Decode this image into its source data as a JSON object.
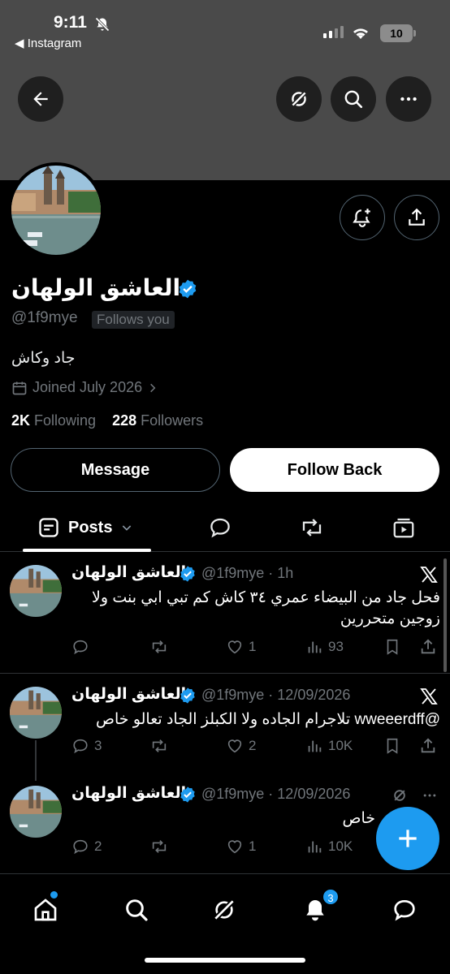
{
  "status_bar": {
    "time": "9:11",
    "back_app": "◀ Instagram",
    "battery": "10"
  },
  "icons": {
    "back": "arrow-left-icon",
    "grok": "grok-icon",
    "search": "search-icon",
    "more": "more-horizontal-icon",
    "notify": "bell-plus-icon",
    "share": "share-icon",
    "verified": "verified-badge-icon",
    "calendar": "calendar-icon",
    "chevron_right": "chevron-right-icon",
    "x_logo": "x-logo-icon",
    "posts_tab": "posts-icon",
    "replies_tab": "reply-icon",
    "reposts_tab": "repost-icon",
    "media_tab": "media-icon",
    "home": "home-icon",
    "explore": "search-icon",
    "grok_nav": "grok-icon",
    "notifications": "bell-icon",
    "messages": "message-icon"
  },
  "colors": {
    "accent": "#1d9bf0",
    "muted": "#71767b",
    "banner": "#4a4a4a"
  },
  "profile": {
    "name": "العاشق الولهان",
    "handle": "@1f9mye",
    "follows_you": "Follows you",
    "bio": "جاد وكاش",
    "joined": "Joined July 2026",
    "following_count": "2K",
    "following_label": "Following",
    "followers_count": "228",
    "followers_label": "Followers"
  },
  "buttons": {
    "message": "Message",
    "follow_back": "Follow Back"
  },
  "tabs": {
    "posts": "Posts"
  },
  "posts": [
    {
      "name": "العاشق الولهان",
      "meta": "@1f9mye · 1h",
      "text": "فحل جاد من البيضاء عمري ٣٤ كاش كم تبي ابي بنت ولا زوجين متحررين",
      "replies": "",
      "reposts": "",
      "likes": "1",
      "views": "93"
    },
    {
      "name": "العاشق الولهان",
      "meta": "@1f9mye · 12/09/2026",
      "text": "@wweeerdff تلاجرام الجاده ولا الكبلز الجاد تعالو خاص",
      "replies": "3",
      "reposts": "",
      "likes": "2",
      "views": "10K"
    },
    {
      "name": "العاشق الولهان",
      "meta": "@1f9mye · 12/09/2026",
      "text": "خاص",
      "replies": "2",
      "reposts": "",
      "likes": "1",
      "views": "10K"
    }
  ],
  "nav": {
    "notifications_badge": "3"
  }
}
